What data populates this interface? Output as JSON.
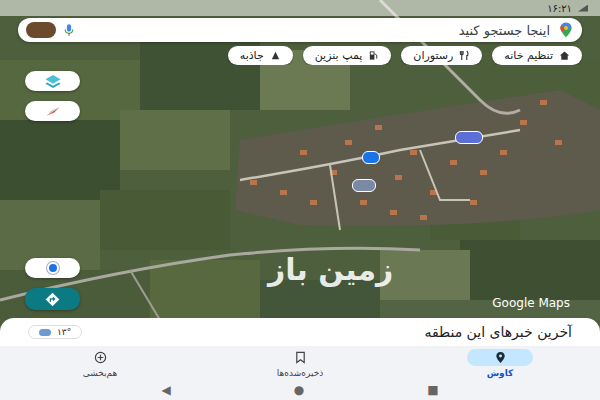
{
  "status_bar": {
    "time": "۱۶:۲۱"
  },
  "search": {
    "placeholder": "اینجا جستجو کنید"
  },
  "chips": [
    {
      "label": "تنظیم خانه",
      "kind": "home"
    },
    {
      "label": "رستوران",
      "kind": "food"
    },
    {
      "label": "پمپ بنزین",
      "kind": "fuel"
    },
    {
      "label": "جاذبه",
      "kind": "attraction"
    }
  ],
  "map": {
    "watermark": "زمین باز",
    "attribution": "Google Maps"
  },
  "sheet": {
    "title": "آخرین خبرهای این منطقه",
    "weather": "۱۳°"
  },
  "nav": [
    {
      "label": "کاوش",
      "kind": "explore",
      "selected": true
    },
    {
      "label": "ذخیره‌شده‌ها",
      "kind": "saved",
      "selected": false
    },
    {
      "label": "هم‌بخشی",
      "kind": "contribute",
      "selected": false
    }
  ],
  "system_nav": [
    "◀",
    "●",
    "■"
  ]
}
